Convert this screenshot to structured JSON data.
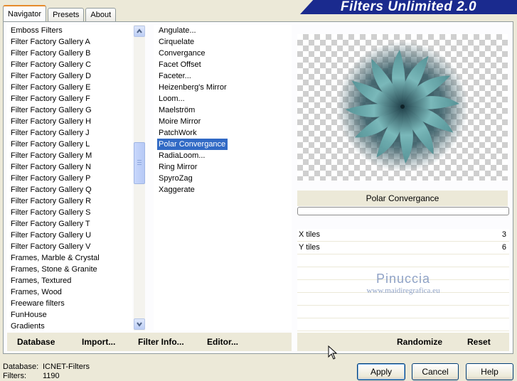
{
  "tabs": [
    {
      "label": "Navigator",
      "active": true
    },
    {
      "label": "Presets",
      "active": false
    },
    {
      "label": "About",
      "active": false
    }
  ],
  "app_title": "Filters Unlimited 2.0",
  "categories": [
    "Emboss Filters",
    "Filter Factory Gallery A",
    "Filter Factory Gallery B",
    "Filter Factory Gallery C",
    "Filter Factory Gallery D",
    "Filter Factory Gallery E",
    "Filter Factory Gallery F",
    "Filter Factory Gallery G",
    "Filter Factory Gallery H",
    "Filter Factory Gallery J",
    "Filter Factory Gallery L",
    "Filter Factory Gallery M",
    "Filter Factory Gallery N",
    "Filter Factory Gallery P",
    "Filter Factory Gallery Q",
    "Filter Factory Gallery R",
    "Filter Factory Gallery S",
    "Filter Factory Gallery T",
    "Filter Factory Gallery U",
    "Filter Factory Gallery V",
    "Frames, Marble & Crystal",
    "Frames, Stone & Granite",
    "Frames, Textured",
    "Frames, Wood",
    "Freeware filters",
    "FunHouse",
    "Gradients"
  ],
  "selected_category": "FunHouse",
  "filters": [
    "Angulate...",
    "Cirquelate",
    "Convergance",
    "Facet Offset",
    "Faceter...",
    "Heizenberg's Mirror",
    "Loom...",
    "Maelström",
    "Moire Mirror",
    "PatchWork",
    "Polar Convergance",
    "RadiaLoom...",
    "Ring Mirror",
    "SpyroZag",
    "Xaggerate"
  ],
  "selected_filter": "Polar Convergance",
  "left_toolbar": {
    "database": "Database",
    "import": "Import...",
    "filter_info": "Filter Info...",
    "editor": "Editor..."
  },
  "right_toolbar": {
    "randomize": "Randomize",
    "reset": "Reset"
  },
  "preview_label": "Polar Convergance",
  "params": [
    {
      "name": "X tiles",
      "value": "3"
    },
    {
      "name": "Y tiles",
      "value": "6"
    }
  ],
  "watermark": {
    "name": "Pinuccia",
    "url": "www.maidiregrafica.eu"
  },
  "status": {
    "database_label": "Database:",
    "database_value": "ICNET-Filters",
    "filters_label": "Filters:",
    "filters_value": "1190"
  },
  "dialog": {
    "apply": "Apply",
    "cancel": "Cancel",
    "help": "Help"
  },
  "colors": {
    "selection": "#316ac5",
    "title_bar": "#1a2a8e",
    "face": "#ece9d8",
    "flower": "#5f9c9e"
  }
}
